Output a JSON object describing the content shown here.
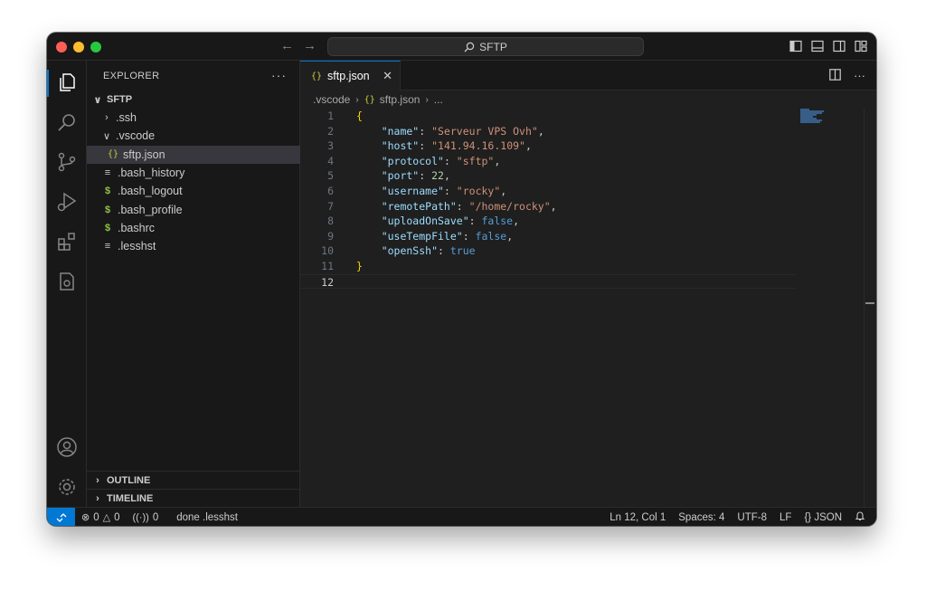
{
  "titlebar": {
    "search_text": "SFTP",
    "nav_back_icon": "arrow-left-icon",
    "nav_forward_icon": "arrow-right-icon"
  },
  "sidebar": {
    "title": "EXPLORER",
    "more": "···",
    "folder": "SFTP",
    "tree": [
      {
        "label": ".ssh",
        "type": "folder",
        "expanded": false,
        "indent": 1
      },
      {
        "label": ".vscode",
        "type": "folder",
        "expanded": true,
        "indent": 1
      },
      {
        "label": "sftp.json",
        "type": "json",
        "indent": 2,
        "selected": true
      },
      {
        "label": ".bash_history",
        "type": "text",
        "indent": 1
      },
      {
        "label": ".bash_logout",
        "type": "shell",
        "indent": 1
      },
      {
        "label": ".bash_profile",
        "type": "shell",
        "indent": 1
      },
      {
        "label": ".bashrc",
        "type": "shell",
        "indent": 1
      },
      {
        "label": ".lesshst",
        "type": "text",
        "indent": 1
      }
    ],
    "outline": "OUTLINE",
    "timeline": "TIMELINE"
  },
  "editor": {
    "tab_label": "sftp.json",
    "tab_icon": "{}",
    "breadcrumb": {
      "folder": ".vscode",
      "file": "sftp.json",
      "tail": "..."
    },
    "current_line": 12,
    "lines": [
      [
        {
          "t": "brace",
          "v": "{"
        }
      ],
      [
        {
          "t": "key",
          "v": "    \"name\""
        },
        {
          "t": "punc",
          "v": ": "
        },
        {
          "t": "str",
          "v": "\"Serveur VPS Ovh\""
        },
        {
          "t": "punc",
          "v": ","
        }
      ],
      [
        {
          "t": "key",
          "v": "    \"host\""
        },
        {
          "t": "punc",
          "v": ": "
        },
        {
          "t": "str",
          "v": "\"141.94.16.109\""
        },
        {
          "t": "punc",
          "v": ","
        }
      ],
      [
        {
          "t": "key",
          "v": "    \"protocol\""
        },
        {
          "t": "punc",
          "v": ": "
        },
        {
          "t": "str",
          "v": "\"sftp\""
        },
        {
          "t": "punc",
          "v": ","
        }
      ],
      [
        {
          "t": "key",
          "v": "    \"port\""
        },
        {
          "t": "punc",
          "v": ": "
        },
        {
          "t": "num",
          "v": "22"
        },
        {
          "t": "punc",
          "v": ","
        }
      ],
      [
        {
          "t": "key",
          "v": "    \"username\""
        },
        {
          "t": "punc",
          "v": ": "
        },
        {
          "t": "str",
          "v": "\"rocky\""
        },
        {
          "t": "punc",
          "v": ","
        }
      ],
      [
        {
          "t": "key",
          "v": "    \"remotePath\""
        },
        {
          "t": "punc",
          "v": ": "
        },
        {
          "t": "str",
          "v": "\"/home/rocky\""
        },
        {
          "t": "punc",
          "v": ","
        }
      ],
      [
        {
          "t": "key",
          "v": "    \"uploadOnSave\""
        },
        {
          "t": "punc",
          "v": ": "
        },
        {
          "t": "bool",
          "v": "false"
        },
        {
          "t": "punc",
          "v": ","
        }
      ],
      [
        {
          "t": "key",
          "v": "    \"useTempFile\""
        },
        {
          "t": "punc",
          "v": ": "
        },
        {
          "t": "bool",
          "v": "false"
        },
        {
          "t": "punc",
          "v": ","
        }
      ],
      [
        {
          "t": "key",
          "v": "    \"openSsh\""
        },
        {
          "t": "punc",
          "v": ": "
        },
        {
          "t": "bool",
          "v": "true"
        }
      ],
      [
        {
          "t": "brace",
          "v": "}"
        }
      ],
      []
    ]
  },
  "statusbar": {
    "errors": "0",
    "warnings": "0",
    "ports": "0",
    "message": "done .lesshst",
    "position": "Ln 12, Col 1",
    "spaces": "Spaces: 4",
    "encoding": "UTF-8",
    "eol": "LF",
    "language": "JSON",
    "language_icon": "{}"
  },
  "colors": {
    "accent": "#0078d4",
    "json_icon": "#cbcb41",
    "shell_icon": "#8dc149"
  }
}
